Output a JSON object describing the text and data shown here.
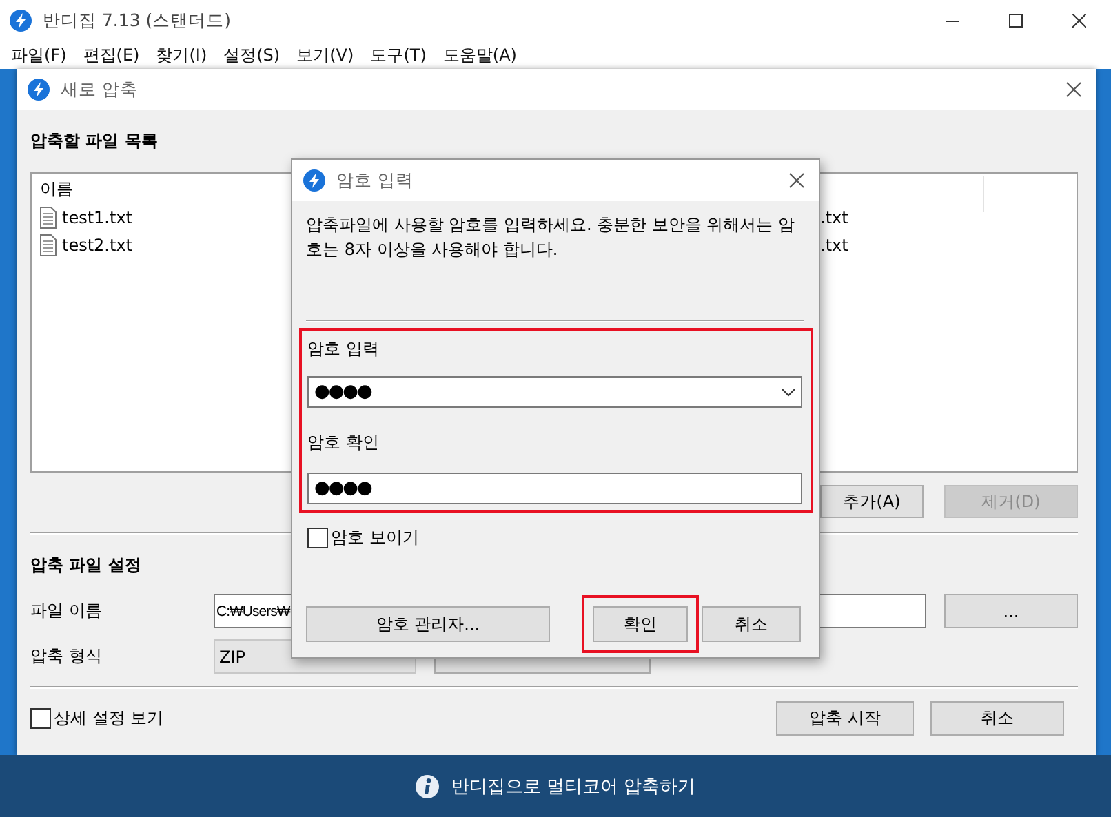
{
  "app": {
    "title": "반디집 7.13 (스탠더드)",
    "menu": [
      "파일(F)",
      "편집(E)",
      "찾기(I)",
      "설정(S)",
      "보기(V)",
      "도구(T)",
      "도움말(A)"
    ]
  },
  "new_archive_dialog": {
    "title": "새로 압축",
    "file_list": {
      "heading": "압축할 파일 목록",
      "columns": [
        "이름"
      ],
      "rows": [
        {
          "name": "test1.txt",
          "column_2": ".txt"
        },
        {
          "name": "test2.txt",
          "column_2": ".txt"
        }
      ]
    },
    "list_buttons": [
      {
        "label": "추가(A)",
        "disabled": false
      },
      {
        "label": "제거(D)",
        "disabled": true
      }
    ],
    "settings": {
      "heading": "압축 파일 설정",
      "file_name": {
        "label": "파일 이름",
        "value": "C:₩Users₩"
      },
      "browse_button": "...",
      "format": {
        "label": "압축 형식",
        "value": "ZIP"
      }
    },
    "advanced": {
      "label": "상세 설정 보기",
      "checked": false
    },
    "buttons": [
      "압축 시작",
      "취소"
    ]
  },
  "password_dialog": {
    "title": "암호 입력",
    "message": "압축파일에 사용할 암호를 입력하세요. 충분한 보안을 위해서는 암호는 8자 이상을 사용해야 합니다.",
    "fields_highlighted": true,
    "fields": [
      {
        "kind": "combo",
        "label": "암호 입력",
        "value": "●●●●"
      },
      {
        "kind": "text",
        "label": "암호 확인",
        "value": "●●●●"
      }
    ],
    "show_password": {
      "label": "암호 보이기",
      "checked": false
    },
    "buttons": [
      {
        "label": "암호 관리자...",
        "highlighted": false
      },
      {
        "label": "확인",
        "highlighted": true
      },
      {
        "label": "취소",
        "highlighted": false
      }
    ]
  },
  "status_bar": {
    "text": "반디집으로 멀티코어 압축하기"
  }
}
